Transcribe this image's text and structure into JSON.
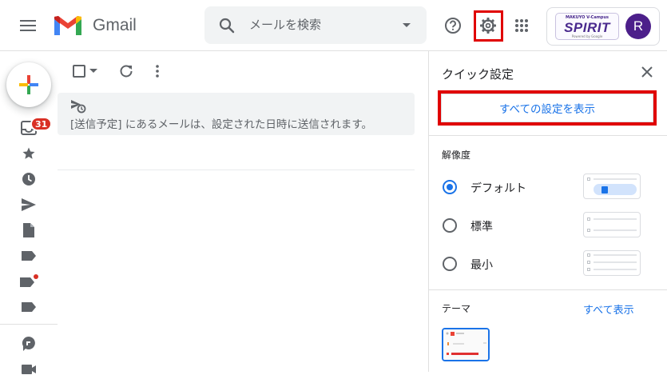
{
  "header": {
    "app_name": "Gmail",
    "search_placeholder": "メールを検索",
    "account": {
      "avatar_letter": "R",
      "org_badge_top": "MAKUYO V-Campus",
      "org_badge_main": "SPIRIT",
      "org_badge_sub": "Powered by Google"
    }
  },
  "sidebar": {
    "inbox_count": "31"
  },
  "main": {
    "notice_text": "[送信予定] にあるメールは、設定された日時に送信されます。"
  },
  "quick_settings": {
    "title": "クイック設定",
    "see_all_settings": "すべての設定を表示",
    "density": {
      "label": "解像度",
      "options": [
        {
          "label": "デフォルト",
          "selected": true
        },
        {
          "label": "標準",
          "selected": false
        },
        {
          "label": "最小",
          "selected": false
        }
      ]
    },
    "theme": {
      "label": "テーマ",
      "see_all": "すべて表示"
    }
  },
  "colors": {
    "accent": "#1a73e8",
    "highlight": "#e00000",
    "badge": "#d93025",
    "avatar": "#4c1f8a"
  }
}
